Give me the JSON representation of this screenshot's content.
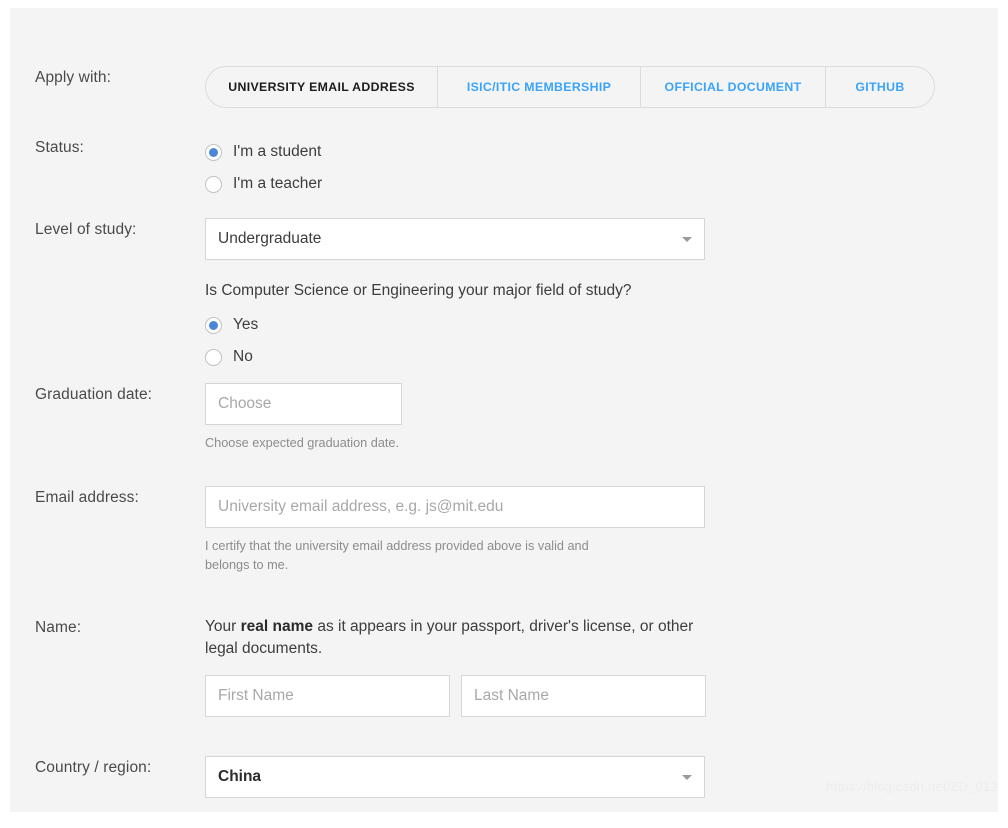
{
  "apply_with": {
    "label": "Apply with:",
    "tabs": [
      {
        "label": "UNIVERSITY EMAIL ADDRESS",
        "active": true
      },
      {
        "label": "ISIC/ITIC MEMBERSHIP",
        "active": false
      },
      {
        "label": "OFFICIAL DOCUMENT",
        "active": false
      },
      {
        "label": "GITHUB",
        "active": false
      }
    ]
  },
  "status": {
    "label": "Status:",
    "options": [
      {
        "label": "I'm a student",
        "selected": true
      },
      {
        "label": "I'm a teacher",
        "selected": false
      }
    ]
  },
  "level_of_study": {
    "label": "Level of study:",
    "value": "Undergraduate",
    "question": "Is Computer Science or Engineering your major field of study?",
    "options": [
      {
        "label": "Yes",
        "selected": true
      },
      {
        "label": "No",
        "selected": false
      }
    ]
  },
  "graduation_date": {
    "label": "Graduation date:",
    "value": "",
    "placeholder": "Choose",
    "help": "Choose expected graduation date."
  },
  "email_address": {
    "label": "Email address:",
    "value": "",
    "placeholder": "University email address, e.g. js@mit.edu",
    "help": "I certify that the university email address provided above is valid and belongs to me."
  },
  "name": {
    "label": "Name:",
    "note_prefix": "Your ",
    "note_bold": "real name",
    "note_suffix": " as it appears in your passport, driver's license, or other legal documents.",
    "first_value": "",
    "first_placeholder": "First Name",
    "last_value": "",
    "last_placeholder": "Last Name"
  },
  "country_region": {
    "label": "Country / region:",
    "value": "China"
  },
  "watermark": "https://blog.csdn.net/ZD_012",
  "colors": {
    "accent_blue": "#3aa3fb",
    "radio_blue": "#4a86d4",
    "background": "#f4f4f4",
    "border": "#d6d6d6"
  }
}
